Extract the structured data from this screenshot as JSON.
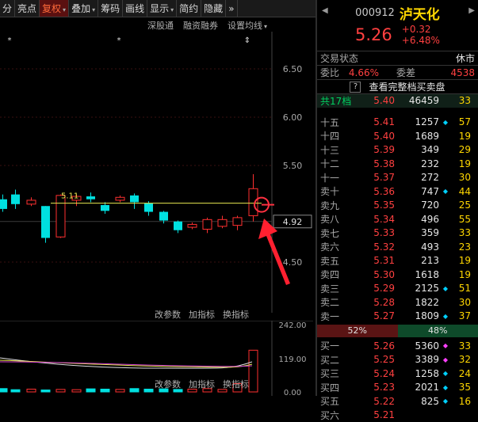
{
  "toolbar": {
    "items": [
      {
        "label": "分",
        "dropdown": false
      },
      {
        "label": "亮点",
        "dropdown": false
      },
      {
        "label": "复权",
        "dropdown": true,
        "active": true
      },
      {
        "label": "叠加",
        "dropdown": true
      },
      {
        "label": "筹码",
        "dropdown": false
      },
      {
        "label": "画线",
        "dropdown": false
      },
      {
        "label": "显示",
        "dropdown": true
      },
      {
        "label": "简约",
        "dropdown": false
      },
      {
        "label": "隐藏",
        "dropdown": false
      }
    ],
    "more_icon": "double-chevron-right-icon",
    "dropdown_glyph": "▾",
    "more_glyph": "»"
  },
  "subbar": {
    "items": [
      "深股通",
      "融资融券",
      "设置均线"
    ],
    "dropdown_glyph": "▾"
  },
  "chart": {
    "price_ticks": [
      "6.50",
      "6.00",
      "5.50",
      "4.50"
    ],
    "current_price_label": "4.92",
    "line_label": "5.11",
    "markers": [
      "*",
      "*",
      "⇕"
    ]
  },
  "chart_data": {
    "type": "candlestick",
    "y_ticks": [
      4.5,
      5.0,
      5.5,
      6.0,
      6.5
    ],
    "ref_line": 5.11,
    "last_price": 4.92,
    "candles": [
      {
        "o": 5.05,
        "c": 5.15,
        "h": 5.2,
        "l": 5.02,
        "up": false
      },
      {
        "o": 5.2,
        "c": 5.1,
        "h": 5.25,
        "l": 5.05,
        "up": false
      },
      {
        "o": 5.1,
        "c": 5.14,
        "h": 5.17,
        "l": 5.08,
        "up": true
      },
      {
        "o": 5.08,
        "c": 4.75,
        "h": 5.08,
        "l": 4.7,
        "up": false
      },
      {
        "o": 4.76,
        "c": 5.19,
        "h": 5.2,
        "l": 4.75,
        "up": true
      },
      {
        "o": 5.14,
        "c": 5.18,
        "h": 5.2,
        "l": 5.08,
        "up": true
      },
      {
        "o": 5.18,
        "c": 5.15,
        "h": 5.22,
        "l": 5.12,
        "up": false
      },
      {
        "o": 5.09,
        "c": 5.03,
        "h": 5.12,
        "l": 5.0,
        "up": false
      },
      {
        "o": 5.14,
        "c": 5.17,
        "h": 5.19,
        "l": 5.12,
        "up": true
      },
      {
        "o": 5.19,
        "c": 5.12,
        "h": 5.21,
        "l": 5.05,
        "up": false
      },
      {
        "o": 5.11,
        "c": 5.02,
        "h": 5.13,
        "l": 4.98,
        "up": false
      },
      {
        "o": 5.02,
        "c": 4.93,
        "h": 5.03,
        "l": 4.9,
        "up": false
      },
      {
        "o": 4.92,
        "c": 4.83,
        "h": 4.93,
        "l": 4.8,
        "up": false
      },
      {
        "o": 4.86,
        "c": 4.89,
        "h": 4.91,
        "l": 4.84,
        "up": true
      },
      {
        "o": 4.84,
        "c": 4.94,
        "h": 4.96,
        "l": 4.8,
        "up": true
      },
      {
        "o": 4.87,
        "c": 4.94,
        "h": 4.98,
        "l": 4.85,
        "up": true
      },
      {
        "o": 4.88,
        "c": 4.96,
        "h": 4.98,
        "l": 4.83,
        "up": true
      },
      {
        "o": 4.98,
        "c": 5.26,
        "h": 5.41,
        "l": 4.92,
        "up": true
      }
    ],
    "volume": {
      "y_ticks": [
        0,
        119,
        242
      ],
      "bars": [
        12,
        8,
        10,
        7,
        9,
        8,
        11,
        10,
        9,
        12,
        10,
        11,
        9,
        10,
        12,
        9,
        30,
        150
      ],
      "up": [
        false,
        false,
        true,
        false,
        true,
        true,
        false,
        false,
        true,
        false,
        false,
        false,
        false,
        true,
        true,
        true,
        true,
        true
      ]
    }
  },
  "volume": {
    "tick_labels": [
      "242.00",
      "119.00",
      "0.00"
    ],
    "header": [
      "改参数",
      "加指标",
      "换指标"
    ]
  },
  "right": {
    "code": "000912",
    "name": "泸天化",
    "price": "5.26",
    "change": "+0.32",
    "change_pct": "+6.48%",
    "status_label": "交易状态",
    "status_value": "休市",
    "webi_label": "委比",
    "webi_value": "4.66%",
    "weicha_label": "委差",
    "weicha_value": "4538",
    "view_full": "查看完整档买卖盘",
    "help_glyph": "?",
    "total_label": "共17档",
    "total_price": "5.40",
    "total_vol": "46459",
    "total_count": "33",
    "asks": [
      {
        "label": "十五",
        "price": "5.41",
        "vol": "1257",
        "flag": "◆",
        "flag_color": "#00d0ff",
        "n": "57"
      },
      {
        "label": "十四",
        "price": "5.40",
        "vol": "1689",
        "flag": "",
        "n": "19"
      },
      {
        "label": "十三",
        "price": "5.39",
        "vol": "349",
        "flag": "",
        "n": "29"
      },
      {
        "label": "十二",
        "price": "5.38",
        "vol": "232",
        "flag": "",
        "n": "19"
      },
      {
        "label": "十一",
        "price": "5.37",
        "vol": "272",
        "flag": "",
        "n": "30"
      },
      {
        "label": "卖十",
        "price": "5.36",
        "vol": "747",
        "flag": "◆",
        "flag_color": "#00d0ff",
        "n": "44"
      },
      {
        "label": "卖九",
        "price": "5.35",
        "vol": "720",
        "flag": "",
        "n": "25"
      },
      {
        "label": "卖八",
        "price": "5.34",
        "vol": "496",
        "flag": "",
        "n": "55"
      },
      {
        "label": "卖七",
        "price": "5.33",
        "vol": "359",
        "flag": "",
        "n": "33"
      },
      {
        "label": "卖六",
        "price": "5.32",
        "vol": "493",
        "flag": "",
        "n": "23"
      },
      {
        "label": "卖五",
        "price": "5.31",
        "vol": "213",
        "flag": "",
        "n": "19"
      },
      {
        "label": "卖四",
        "price": "5.30",
        "vol": "1618",
        "flag": "",
        "n": "19"
      },
      {
        "label": "卖三",
        "price": "5.29",
        "vol": "2125",
        "flag": "◆",
        "flag_color": "#00d0ff",
        "n": "51"
      },
      {
        "label": "卖二",
        "price": "5.28",
        "vol": "1822",
        "flag": "",
        "n": "30"
      },
      {
        "label": "卖一",
        "price": "5.27",
        "vol": "1809",
        "flag": "◆",
        "flag_color": "#00d0ff",
        "n": "37"
      }
    ],
    "ratio_left": "52%",
    "ratio_right": "48%",
    "bids": [
      {
        "label": "买一",
        "price": "5.26",
        "vol": "5360",
        "flag": "◆",
        "flag_color": "#ff40ff",
        "n": "33"
      },
      {
        "label": "买二",
        "price": "5.25",
        "vol": "3389",
        "flag": "◆",
        "flag_color": "#ff40ff",
        "n": "32"
      },
      {
        "label": "买三",
        "price": "5.24",
        "vol": "1258",
        "flag": "◆",
        "flag_color": "#00d0ff",
        "n": "24"
      },
      {
        "label": "买四",
        "price": "5.23",
        "vol": "2021",
        "flag": "◆",
        "flag_color": "#00d0ff",
        "n": "35"
      },
      {
        "label": "买五",
        "price": "5.22",
        "vol": "825",
        "flag": "◆",
        "flag_color": "#00d0ff",
        "n": "16"
      },
      {
        "label": "买六",
        "price": "5.21",
        "vol": "",
        "flag": "",
        "n": ""
      }
    ]
  }
}
